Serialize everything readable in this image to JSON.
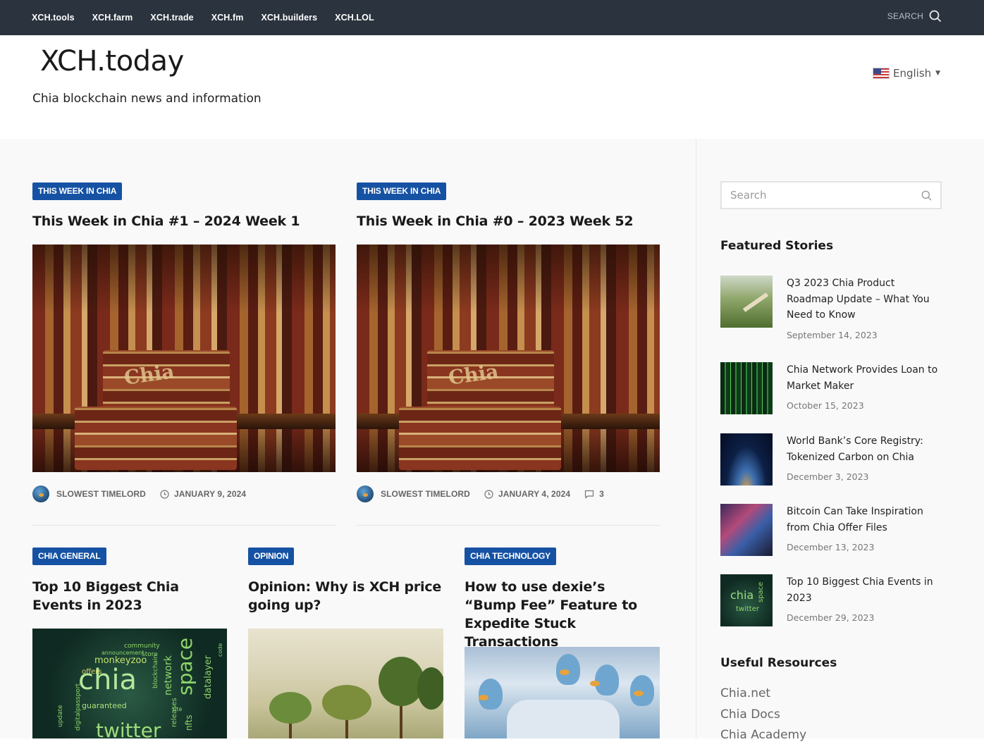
{
  "topnav": {
    "links": [
      "XCH.tools",
      "XCH.farm",
      "XCH.trade",
      "XCH.fm",
      "XCH.builders",
      "XCH.LOL"
    ],
    "search_label": "SEARCH"
  },
  "header": {
    "logo": "XCH.today",
    "tagline": "Chia blockchain news and information",
    "language": "English"
  },
  "posts": [
    {
      "category": "THIS WEEK IN CHIA",
      "title": "This Week in Chia #1 – 2024 Week 1",
      "author": "SLOWEST TIMELORD",
      "date": "JANUARY 9, 2024",
      "image_text": "Chia"
    },
    {
      "category": "THIS WEEK IN CHIA",
      "title": "This Week in Chia #0 – 2023 Week 52",
      "author": "SLOWEST TIMELORD",
      "date": "JANUARY 4, 2024",
      "comments": "3",
      "image_text": "Chia"
    },
    {
      "category": "CHIA GENERAL",
      "title": "Top 10 Biggest Chia Events in 2023"
    },
    {
      "category": "OPINION",
      "title": "Opinion: Why is XCH price going up?"
    },
    {
      "category": "CHIA TECHNOLOGY",
      "title": "How to use dexie’s “Bump Fee” Feature to Expedite Stuck Transactions"
    }
  ],
  "wordcloud": {
    "words": [
      "chia",
      "space",
      "twitter",
      "monkeyzoo",
      "network",
      "datalayer",
      "blockchain",
      "community",
      "offers",
      "guaranteed",
      "releases",
      "nfts",
      "digitalpassport",
      "update",
      "store",
      "announcement",
      "code",
      "site"
    ]
  },
  "sidebar": {
    "search_placeholder": "Search",
    "featured_heading": "Featured Stories",
    "featured": [
      {
        "title": "Q3 2023 Chia Product Roadmap Update – What You Need to Know",
        "date": "September 14, 2023"
      },
      {
        "title": "Chia Network Provides Loan to Market Maker",
        "date": "October 15, 2023"
      },
      {
        "title": "World Bank’s Core Registry: Tokenized Carbon on Chia",
        "date": "December 3, 2023"
      },
      {
        "title": "Bitcoin Can Take Inspiration from Chia Offer Files",
        "date": "December 13, 2023"
      },
      {
        "title": "Top 10 Biggest Chia Events in 2023",
        "date": "December 29, 2023",
        "image_text": [
          "chia",
          "space",
          "twitter"
        ]
      }
    ],
    "resources_heading": "Useful Resources",
    "resources": [
      "Chia.net",
      "Chia Docs",
      "Chia Academy"
    ]
  },
  "colors": {
    "topbar": "#2b333e",
    "badge": "#1652a3",
    "content_bg": "#f9f9f9"
  }
}
